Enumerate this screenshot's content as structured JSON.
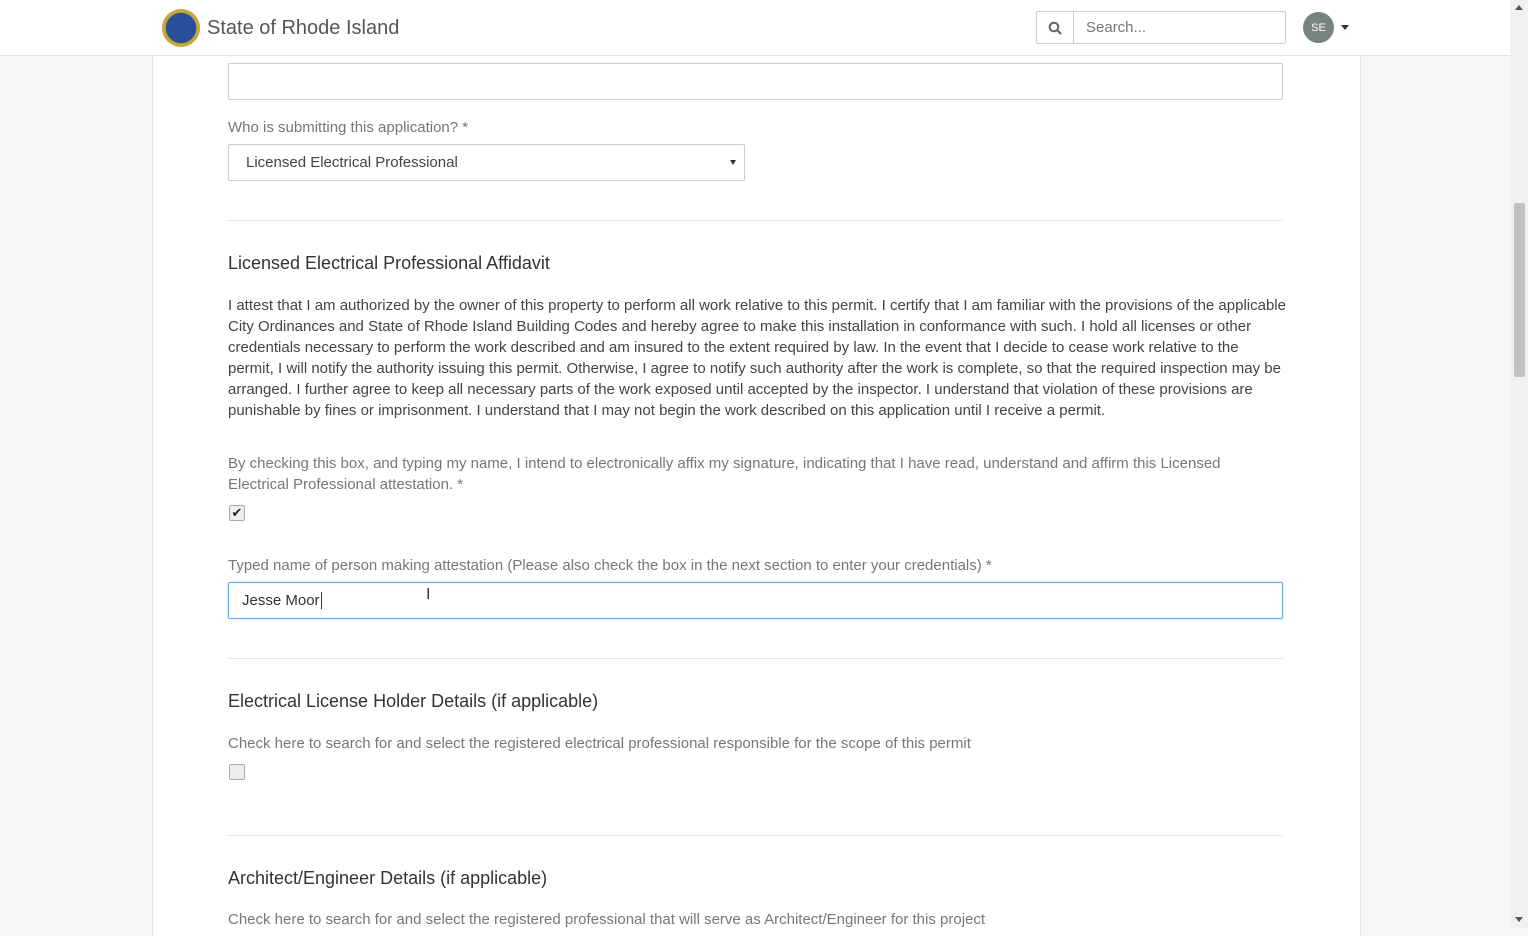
{
  "header": {
    "brand": "State of Rhode Island",
    "search_placeholder": "Search...",
    "avatar_initials": "SE"
  },
  "form": {
    "submitter_label": "Who is submitting this application? *",
    "submitter_value": "Licensed Electrical Professional",
    "affidavit_heading": "Licensed Electrical Professional Affidavit",
    "affidavit_text": "I attest that I am authorized by the owner of this property to perform all work relative to this permit. I certify that I am familiar with the provisions of the applicable City Ordinances and State of Rhode Island Building Codes and hereby agree to make this installation in conformance with such. I hold all licenses or other credentials necessary to perform the work described and am insured to the extent required by law. In the event that I decide to cease work relative to the permit, I will notify the authority issuing this permit. Otherwise, I agree to notify such authority after the work is complete, so that the required inspection may be arranged. I further agree to keep all necessary parts of the work exposed until accepted by the inspector. I understand that violation of these provisions are punishable by fines or imprisonment. I understand that I may not begin the work described on this application until I receive a permit.",
    "attest_label": "By checking this box, and typing my name, I intend to electronically affix my signature, indicating that I have read, understand and affirm this Licensed Electrical Professional attestation. *",
    "attest_checked": "✔",
    "typed_name_label": "Typed name of person making attestation (Please also check the box in the next section to enter your credentials) *",
    "typed_name_value": "Jesse Moor",
    "license_heading": "Electrical License Holder Details (if applicable)",
    "license_label": "Check here to search for and select the registered electrical professional responsible for the scope of this permit",
    "architect_heading": "Architect/Engineer Details (if applicable)",
    "architect_label": "Check here to search for and select the registered professional that will serve as Architect/Engineer for this project"
  }
}
